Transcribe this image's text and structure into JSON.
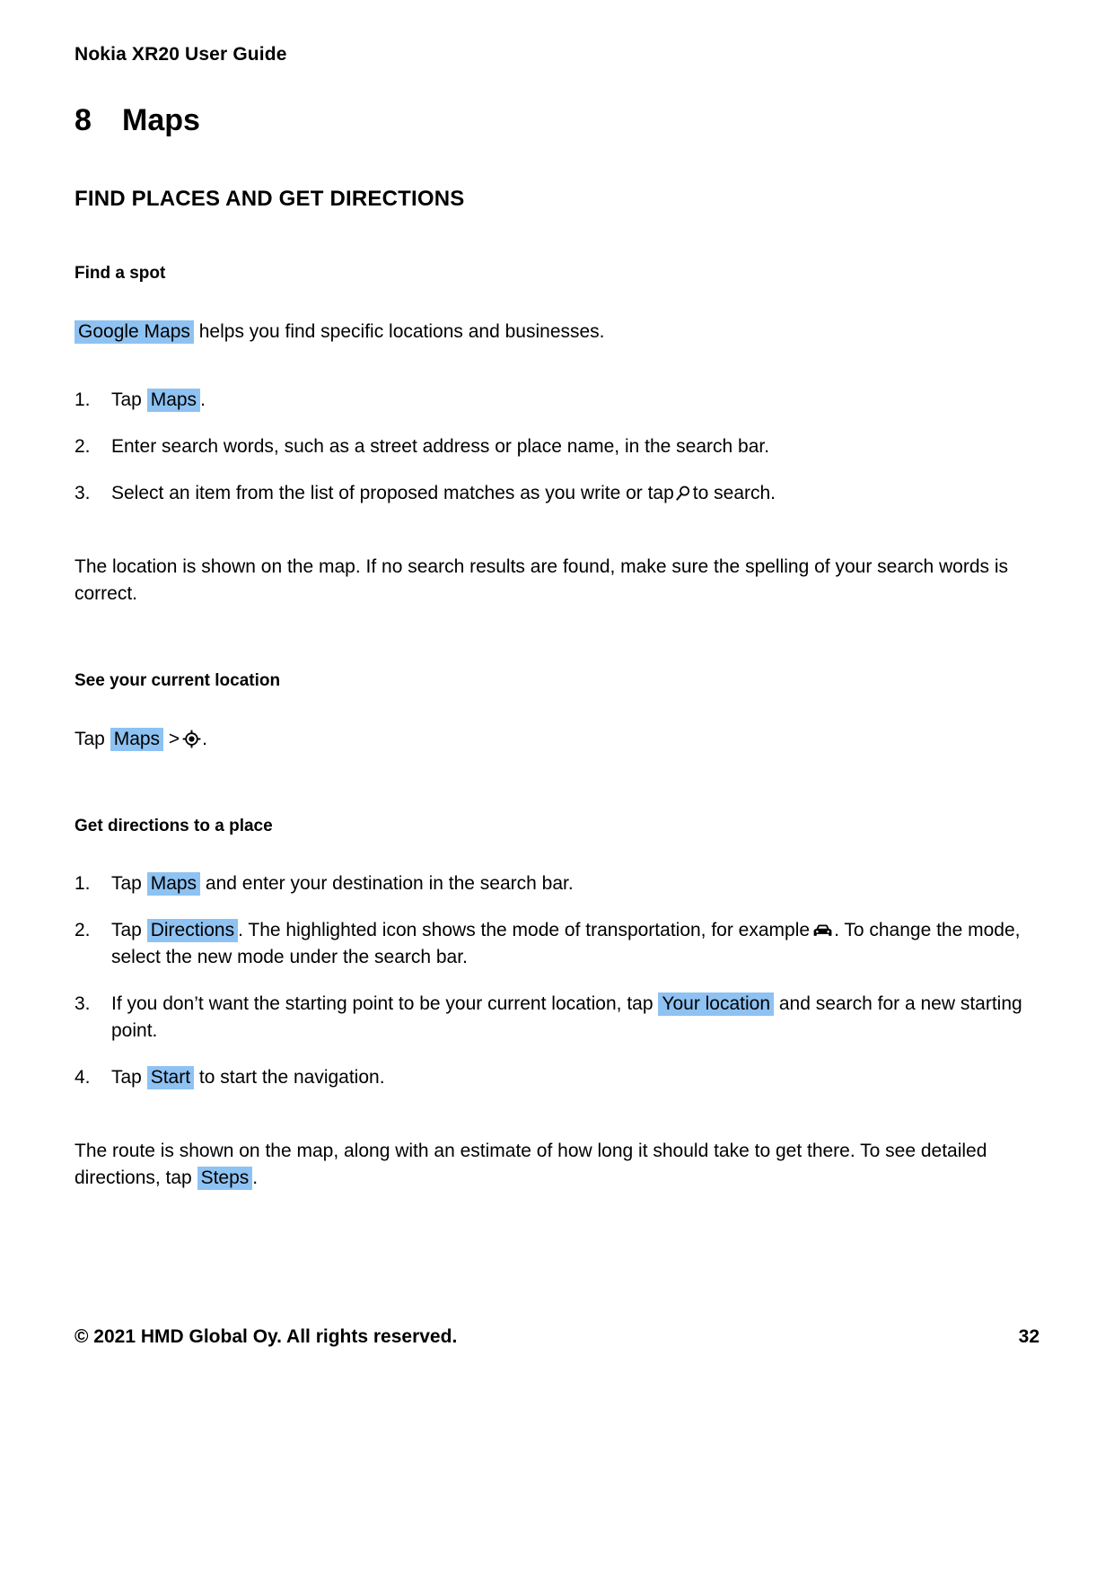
{
  "header": {
    "running_title": "Nokia XR20 User Guide"
  },
  "chapter": {
    "number": "8",
    "title": "Maps"
  },
  "section": {
    "heading": "FIND PLACES AND GET DIRECTIONS"
  },
  "find_a_spot": {
    "heading": "Find a spot",
    "intro_token": "Google Maps",
    "intro_rest": "helps you find specific locations and businesses.",
    "steps": [
      {
        "marker": "1.",
        "before": "Tap",
        "token": "Maps",
        "after": "."
      },
      {
        "marker": "2.",
        "text": "Enter search words, such as a street address or place name, in the search bar."
      },
      {
        "marker": "3.",
        "before": "Select an item from the list of proposed matches as you write or tap",
        "icon": "search-icon",
        "after": "to search."
      }
    ],
    "note": "The location is shown on the map. If no search results are found, make sure the spelling of your search words is correct."
  },
  "current_location": {
    "heading": "See your current location",
    "before": "Tap",
    "token": "Maps",
    "separator": ">",
    "icon": "locate-icon",
    "after": "."
  },
  "get_directions": {
    "heading": "Get directions to a place",
    "steps": [
      {
        "marker": "1.",
        "before": "Tap",
        "token": "Maps",
        "after": "and enter your destination in the search bar."
      },
      {
        "marker": "2.",
        "before": "Tap",
        "token": "Directions",
        "mid": ". The highlighted icon shows the mode of transportation, for example",
        "icon": "car-icon",
        "after": ". To change the mode, select the new mode under the search bar."
      },
      {
        "marker": "3.",
        "before": "If you don’t want the starting point to be your current location, tap",
        "token": "Your location",
        "after": "and search for a new starting point."
      },
      {
        "marker": "4.",
        "before": "Tap",
        "token": "Start",
        "after": "to start the navigation."
      }
    ],
    "outro_before": "The route is shown on the map, along with an estimate of how long it should take to get there. To see detailed directions, tap",
    "outro_token": "Steps",
    "outro_after": "."
  },
  "footer": {
    "copyright": "© 2021 HMD Global Oy. All rights reserved.",
    "page_number": "32"
  },
  "colors": {
    "highlight": "#8ec2f2",
    "text": "#000000",
    "background": "#ffffff"
  }
}
